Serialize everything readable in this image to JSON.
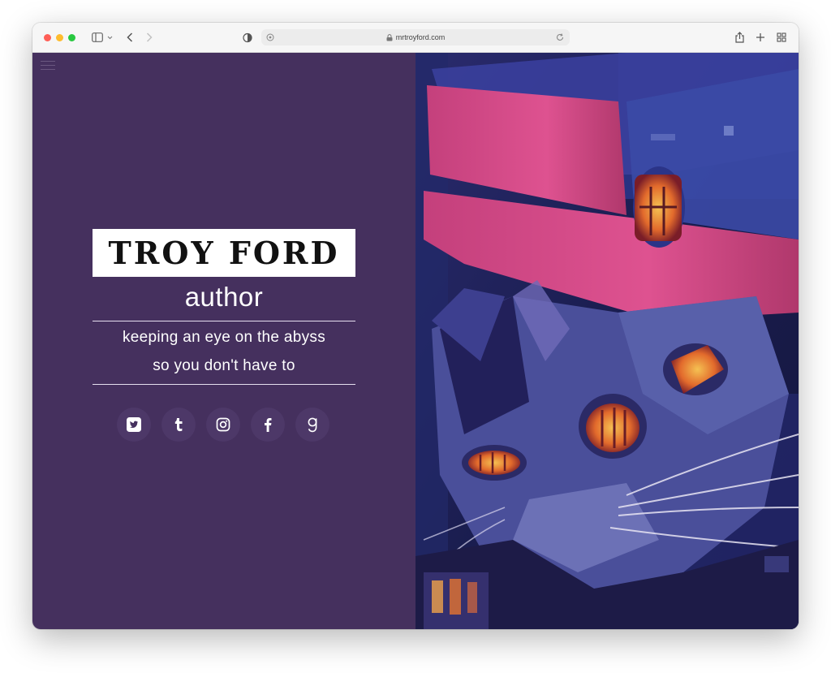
{
  "browser": {
    "url": "mrtroyford.com",
    "icons": {
      "traffic": [
        "close-light",
        "minimize-light",
        "maximize-light"
      ],
      "toolbar": [
        "sidebar-icon",
        "chevron-down-icon",
        "back-icon",
        "forward-icon",
        "shield-icon",
        "lock-icon",
        "reload-icon",
        "share-icon",
        "plus-icon",
        "tab-overview-icon"
      ]
    }
  },
  "hero": {
    "name": "TROY FORD",
    "role": "author",
    "tagline_line1": "keeping an eye on the abyss",
    "tagline_line2": "so you don't have to"
  },
  "social": [
    {
      "name": "twitter",
      "icon": "twitter-icon"
    },
    {
      "name": "tumblr",
      "icon": "tumblr-icon"
    },
    {
      "name": "instagram",
      "icon": "instagram-icon"
    },
    {
      "name": "facebook",
      "icon": "facebook-icon"
    },
    {
      "name": "goodreads",
      "icon": "goodreads-icon"
    }
  ],
  "colors": {
    "panel_bg": "#45305e",
    "name_box_bg": "#ffffff",
    "text_light": "#ffffff",
    "hat_pink": "#d0457f",
    "cat_blue": "#3b4a9a",
    "eye_orange": "#e2622b"
  },
  "artwork": {
    "subject": "painting of a cat wearing a pink top hat"
  }
}
